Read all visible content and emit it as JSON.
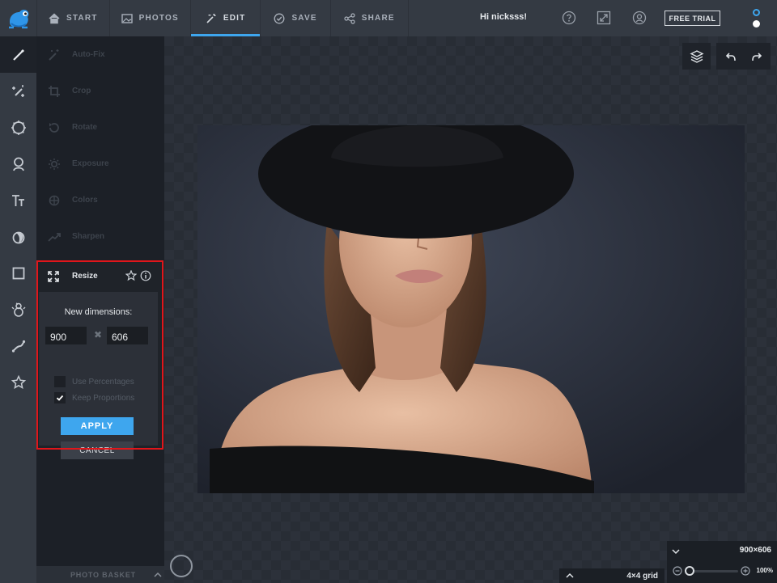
{
  "topbar": {
    "tabs": [
      {
        "label": "START",
        "icon": "home-icon"
      },
      {
        "label": "PHOTOS",
        "icon": "image-icon"
      },
      {
        "label": "EDIT",
        "icon": "magic-wand-icon"
      },
      {
        "label": "SAVE",
        "icon": "check-circle-icon"
      },
      {
        "label": "SHARE",
        "icon": "share-icon"
      }
    ],
    "active_tab": "EDIT",
    "greeting": "Hi nicksss!",
    "free_trial": "FREE TRIAL"
  },
  "rail": {
    "icons": [
      "brush-icon",
      "magic-effects-icon",
      "frame-icon",
      "touchup-icon",
      "text-icon",
      "overlay-icon",
      "shape-icon",
      "stickers-icon",
      "draw-icon",
      "favorites-icon"
    ]
  },
  "tools": {
    "items": [
      {
        "label": "Auto-Fix",
        "icon": "magic-wand-icon"
      },
      {
        "label": "Crop",
        "icon": "crop-icon"
      },
      {
        "label": "Rotate",
        "icon": "rotate-icon"
      },
      {
        "label": "Exposure",
        "icon": "sun-icon"
      },
      {
        "label": "Colors",
        "icon": "crosshair-icon"
      },
      {
        "label": "Sharpen",
        "icon": "trend-icon"
      }
    ]
  },
  "resize": {
    "title": "Resize",
    "new_dimensions_label": "New dimensions:",
    "width": "900",
    "height": "606",
    "times_symbol": "✖",
    "use_percentages": {
      "label": "Use Percentages",
      "checked": false
    },
    "keep_proportions": {
      "label": "Keep Proportions",
      "checked": true
    },
    "apply": "APPLY",
    "cancel": "CANCEL"
  },
  "basket": {
    "label": "PHOTO BASKET"
  },
  "canvas": {
    "grid_label": "4×4 grid",
    "image_size": "900×606",
    "zoom": "100%"
  },
  "colors": {
    "accent": "#3ea6ee",
    "highlight": "#e0161b"
  }
}
